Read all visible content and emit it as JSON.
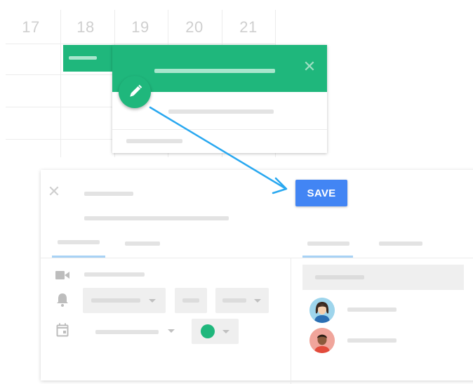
{
  "calendar": {
    "days": [
      "17",
      "18",
      "19",
      "20",
      "21"
    ]
  },
  "toolbar": {
    "save_label": "SAVE"
  },
  "colors": {
    "event_green": "#1fb77c",
    "save_blue": "#4285f4",
    "arrow_blue": "#29a8f0"
  },
  "icons": {
    "popup_close": "close-icon",
    "edit": "pencil-icon",
    "editor_close": "close-icon",
    "video": "video-camera-icon",
    "notification": "bell-icon",
    "calendar": "calendar-icon"
  },
  "glyphs": {
    "close": "✕"
  }
}
